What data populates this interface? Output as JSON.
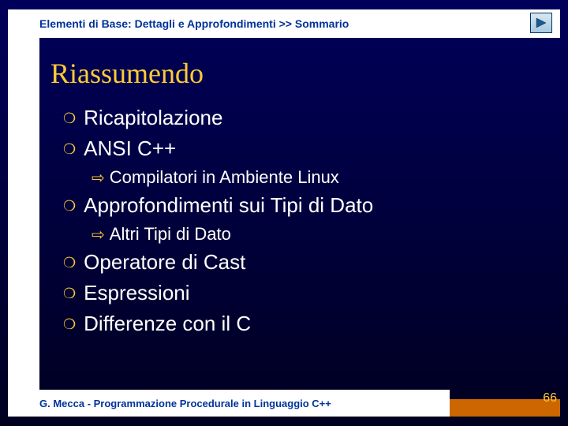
{
  "header": {
    "breadcrumb": "Elementi di Base: Dettagli e Approfondimenti >> Sommario"
  },
  "title": "Riassumendo",
  "bullets": [
    {
      "level": 1,
      "text": "Ricapitolazione"
    },
    {
      "level": 1,
      "text": "ANSI C++"
    },
    {
      "level": 2,
      "text": "Compilatori in Ambiente Linux"
    },
    {
      "level": 1,
      "text": "Approfondimenti sui Tipi di Dato"
    },
    {
      "level": 2,
      "text": "Altri Tipi di Dato"
    },
    {
      "level": 1,
      "text": "Operatore di Cast"
    },
    {
      "level": 1,
      "text": "Espressioni"
    },
    {
      "level": 1,
      "text": "Differenze con il C"
    }
  ],
  "footer": {
    "text": "G. Mecca - Programmazione Procedurale in Linguaggio C++",
    "page": "66"
  }
}
